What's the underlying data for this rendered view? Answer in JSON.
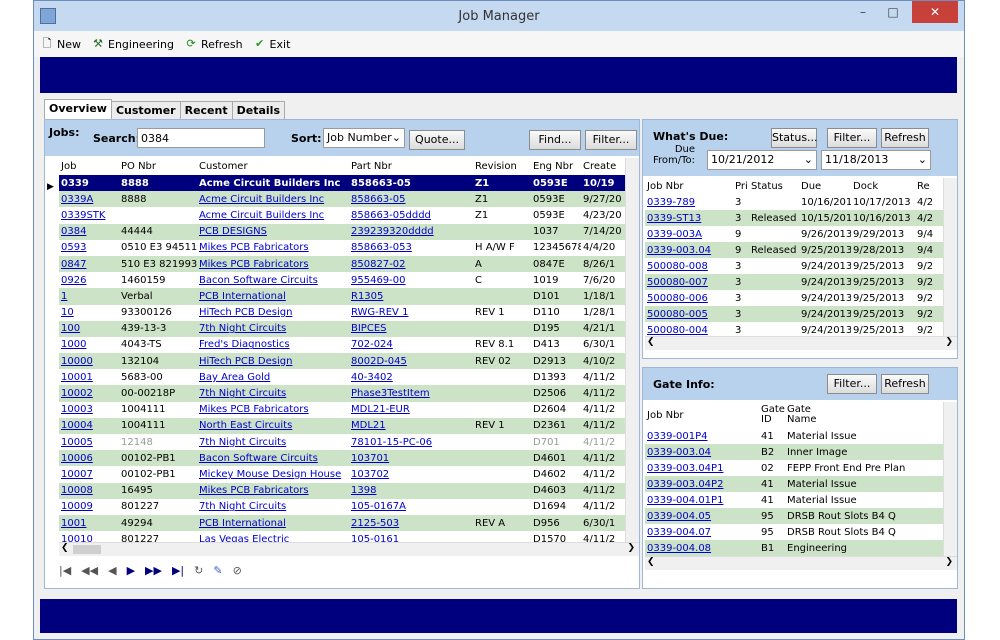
{
  "window": {
    "title": "Job Manager",
    "minimize": "–",
    "maximize": "□",
    "close": "✕"
  },
  "toolbar": {
    "new": "New",
    "engineering": "Engineering",
    "refresh": "Refresh",
    "exit": "Exit"
  },
  "tabs": [
    "Overview",
    "Customer",
    "Recent",
    "Details"
  ],
  "jobs": {
    "label": "Jobs:",
    "search_label": "Search:",
    "search_value": "0384",
    "sort_label": "Sort:",
    "sort_value": "Job Number",
    "quote": "Quote...",
    "find": "Find...",
    "filter": "Filter...",
    "columns": [
      "Job",
      "PO Nbr",
      "Customer",
      "Part Nbr",
      "Revision",
      "Eng Nbr",
      "Create"
    ],
    "rows": [
      [
        "0339",
        "8888",
        "Acme Circuit Builders Inc",
        "858663-05",
        "Z1",
        "0593E",
        "10/19"
      ],
      [
        "0339A",
        "8888",
        "Acme Circuit Builders Inc",
        "858663-05",
        "Z1",
        "0593E",
        "9/27/20"
      ],
      [
        "0339STK",
        "",
        "Acme Circuit Builders Inc",
        "858663-05dddd",
        "Z1",
        "0593E",
        "4/23/20"
      ],
      [
        "0384",
        "44444",
        "PCB DESIGNS",
        "239239320dddd",
        "",
        "1037",
        "7/14/20"
      ],
      [
        "0593",
        "0510 E3 945115",
        "Mikes PCB Fabricators",
        "858663-053",
        "H A/W F",
        "12345678",
        "4/4/20"
      ],
      [
        "0847",
        "510 E3 821993",
        "Mikes PCB Fabricators",
        "850827-02",
        "A",
        "0847E",
        "8/26/1"
      ],
      [
        "0926",
        "1460159",
        "Bacon Software Circuits",
        "955469-00",
        "C",
        "1019",
        "7/6/20"
      ],
      [
        "1",
        "Verbal",
        "PCB International",
        "R1305",
        "",
        "D101",
        "1/18/1"
      ],
      [
        "10",
        "93300126",
        "HiTech PCB Design",
        "RWG-REV 1",
        "REV 1",
        "D110",
        "1/28/1"
      ],
      [
        "100",
        "439-13-3",
        "7th Night Circuits",
        "BIPCES",
        "",
        "D195",
        "4/21/1"
      ],
      [
        "1000",
        "4043-TS",
        "Fred's Diagnostics",
        "702-024",
        "REV 8.1",
        "D413",
        "6/30/1"
      ],
      [
        "10000",
        "132104",
        "HiTech PCB Design",
        "8002D-045",
        "REV 02",
        "D2913",
        "4/10/2"
      ],
      [
        "10001",
        "5683-00",
        "Bay Area Gold",
        "40-3402",
        "",
        "D1393",
        "4/11/2"
      ],
      [
        "10002",
        "00-00218P",
        "7th Night Circuits",
        "Phase3TestItem",
        "",
        "D2506",
        "4/11/2"
      ],
      [
        "10003",
        "1004111",
        "Mikes PCB Fabricators",
        "MDL21-EUR",
        "",
        "D2604",
        "4/11/2"
      ],
      [
        "10004",
        "1004111",
        "North East Circuits",
        "MDL21",
        "REV 1",
        "D2361",
        "4/11/2"
      ],
      [
        "10005",
        "12148",
        "7th Night Circuits",
        "78101-15-PC-06",
        "",
        "D701",
        "4/11/2"
      ],
      [
        "10006",
        "00102-PB1",
        "Bacon Software Circuits",
        "103701",
        "",
        "D4601",
        "4/11/2"
      ],
      [
        "10007",
        "00102-PB1",
        "Mickey Mouse Design House",
        "103702",
        "",
        "D4602",
        "4/11/2"
      ],
      [
        "10008",
        "16495",
        "Mikes PCB Fabricators",
        "1398",
        "",
        "D4603",
        "4/11/2"
      ],
      [
        "10009",
        "801227",
        "7th Night Circuits",
        "105-0167A",
        "",
        "D1694",
        "4/11/2"
      ],
      [
        "1001",
        "49294",
        "PCB International",
        "2125-503",
        "REV A",
        "D956",
        "6/30/1"
      ],
      [
        "10010",
        "801227",
        "Las Vegas Electric",
        "105-0161",
        "",
        "D1570",
        "4/11/2"
      ]
    ]
  },
  "whats_due": {
    "label": "What's Due:",
    "status": "Status...",
    "filter": "Filter...",
    "refresh": "Refresh",
    "due_from_to": "Due\nFrom/To:",
    "from": "10/21/2012",
    "to": "11/18/2013",
    "columns": [
      "Job Nbr",
      "Pri",
      "Status",
      "Due",
      "Dock",
      "Re"
    ],
    "rows": [
      [
        "0339-789",
        "3",
        "",
        "10/16/2013",
        "10/17/2013",
        "4/2"
      ],
      [
        "0339-ST13",
        "3",
        "Released",
        "10/15/2013",
        "10/16/2013",
        "4/2"
      ],
      [
        "0339-003A",
        "9",
        "",
        "9/26/2013",
        "9/29/2013",
        "9/4"
      ],
      [
        "0339-003.04",
        "9",
        "Released",
        "9/25/2013",
        "9/28/2013",
        "9/4"
      ],
      [
        "500080-008",
        "3",
        "",
        "9/24/2013",
        "9/25/2013",
        "9/2"
      ],
      [
        "500080-007",
        "3",
        "",
        "9/24/2013",
        "9/25/2013",
        "9/2"
      ],
      [
        "500080-006",
        "3",
        "",
        "9/24/2013",
        "9/25/2013",
        "9/2"
      ],
      [
        "500080-005",
        "3",
        "",
        "9/24/2013",
        "9/25/2013",
        "9/2"
      ],
      [
        "500080-004",
        "3",
        "",
        "9/24/2013",
        "9/25/2013",
        "9/2"
      ]
    ]
  },
  "gate_info": {
    "label": "Gate Info:",
    "filter": "Filter...",
    "refresh": "Refresh",
    "columns": [
      "Job Nbr",
      "Gate\nID",
      "Gate\nName"
    ],
    "rows": [
      [
        "0339-001P4",
        "41",
        "Material Issue"
      ],
      [
        "0339-003.04",
        "B2",
        "Inner Image"
      ],
      [
        "0339-003.04P1",
        "02",
        "FEPP Front End Pre Plan"
      ],
      [
        "0339-003.04P2",
        "41",
        "Material Issue"
      ],
      [
        "0339-004.01P1",
        "41",
        "Material Issue"
      ],
      [
        "0339-004.05",
        "95",
        "DRSB Rout Slots B4 Q"
      ],
      [
        "0339-004.07",
        "95",
        "DRSB Rout Slots B4 Q"
      ],
      [
        "0339-004.08",
        "B1",
        "Engineering"
      ]
    ]
  },
  "nav": [
    "|◀",
    "◀◀",
    "◀",
    "▶",
    "▶▶",
    "▶|",
    "↻",
    "✎",
    "⊘"
  ]
}
